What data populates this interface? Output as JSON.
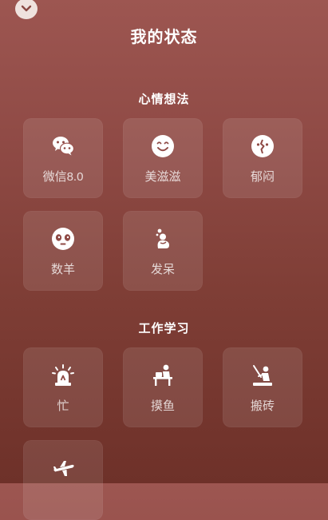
{
  "header": {
    "title": "我的状态"
  },
  "sections": [
    {
      "title": "心情想法",
      "items": [
        {
          "label": "微信8.0",
          "icon": "wechat-icon"
        },
        {
          "label": "美滋滋",
          "icon": "smile-icon"
        },
        {
          "label": "郁闷",
          "icon": "broken-heart-icon"
        },
        {
          "label": "数羊",
          "icon": "sheep-face-icon"
        },
        {
          "label": "发呆",
          "icon": "daydream-icon"
        }
      ]
    },
    {
      "title": "工作学习",
      "items": [
        {
          "label": "忙",
          "icon": "alarm-light-icon"
        },
        {
          "label": "摸鱼",
          "icon": "desk-icon"
        },
        {
          "label": "搬砖",
          "icon": "worker-icon"
        },
        {
          "label": "",
          "icon": "airplane-icon"
        }
      ]
    }
  ]
}
